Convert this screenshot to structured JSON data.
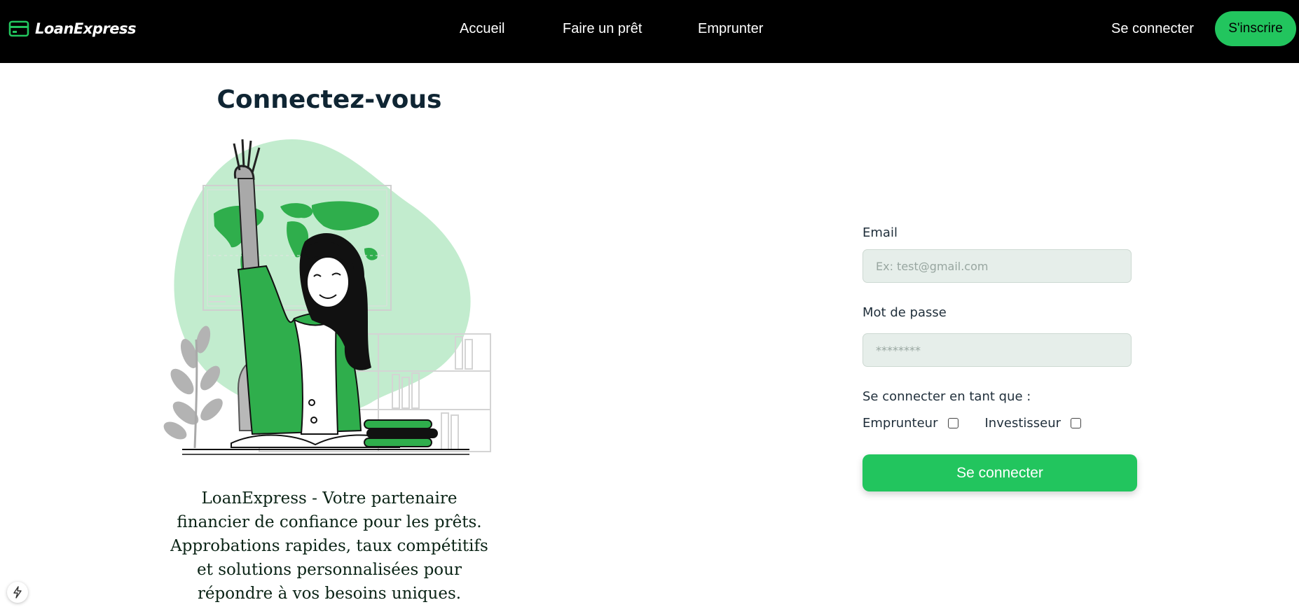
{
  "nav": {
    "brand": "LoanExpress",
    "links": [
      "Accueil",
      "Faire un prêt",
      "Emprunter"
    ],
    "login": "Se connecter",
    "signup": "S'inscrire"
  },
  "main": {
    "title": "Connectez-vous",
    "tagline_lines": [
      "LoanExpress - Votre partenaire",
      "financier de confiance pour les prêts.",
      "Approbations rapides, taux compétitifs",
      "et solutions personnalisées pour",
      "répondre à vos besoins uniques."
    ]
  },
  "form": {
    "email_label": "Email",
    "email_placeholder": "Ex: test@gmail.com",
    "password_label": "Mot de passe",
    "password_placeholder": "********",
    "role_label": "Se connecter en tant que :",
    "roles": [
      "Emprunteur",
      "Investisseur"
    ],
    "submit_label": "Se connecter"
  },
  "colors": {
    "accent": "#22c55e",
    "nav_bg": "#000000",
    "title": "#0f2533",
    "blob": "#c2ecce"
  },
  "icons": {
    "brand": "credit-card-icon",
    "corner": "lightning-icon"
  }
}
